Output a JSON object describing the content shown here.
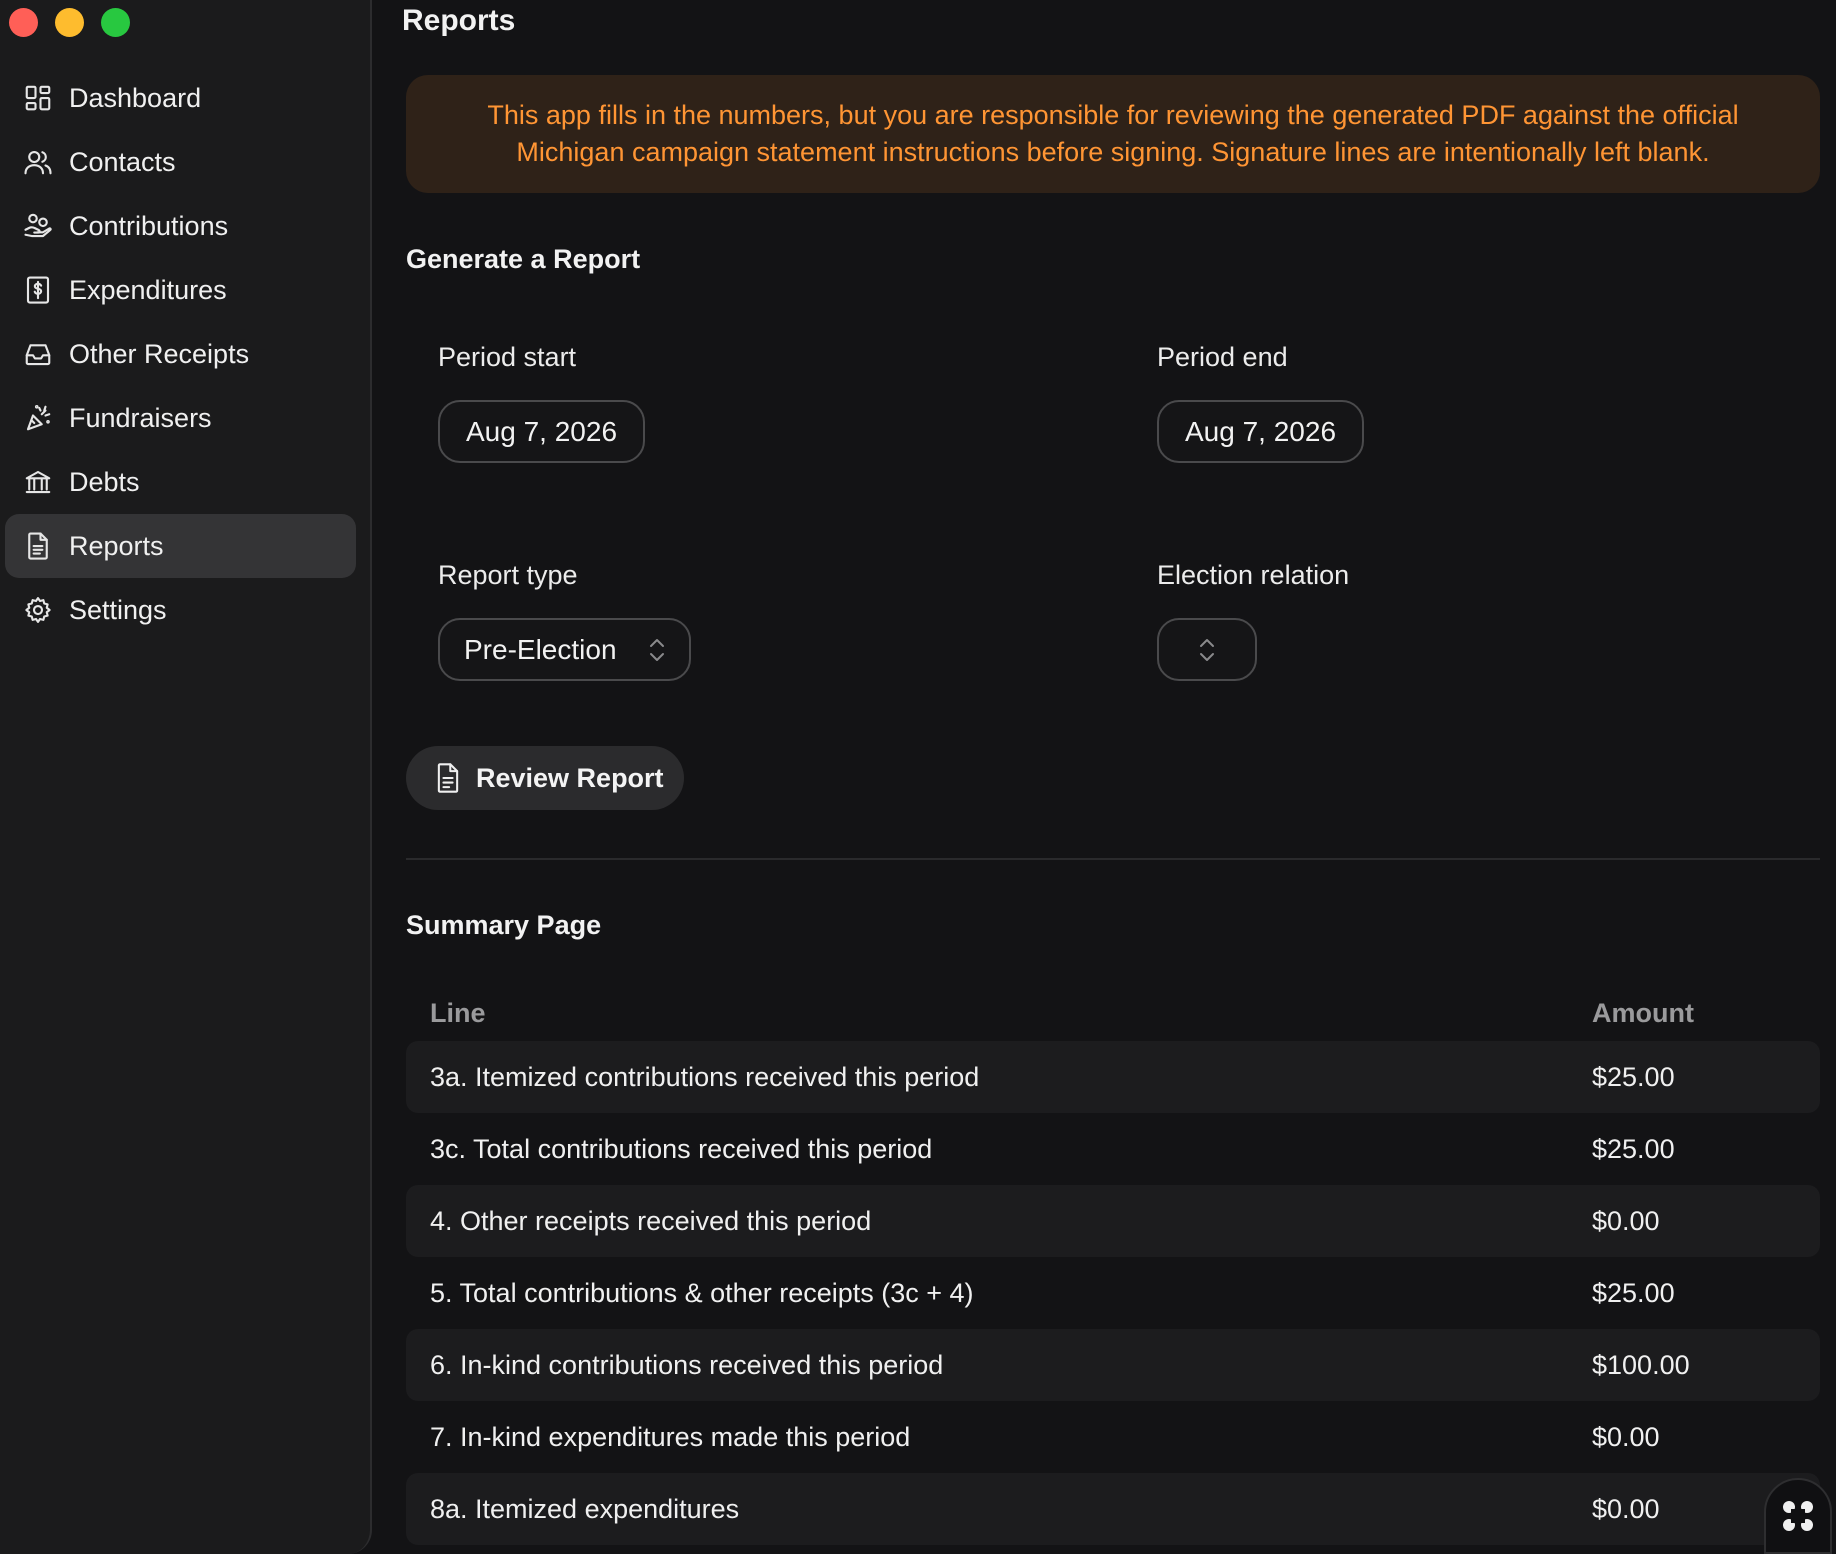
{
  "sidebar": {
    "items": [
      {
        "label": "Dashboard",
        "icon": "dashboard-grid-icon"
      },
      {
        "label": "Contacts",
        "icon": "people-icon"
      },
      {
        "label": "Contributions",
        "icon": "hand-coins-icon"
      },
      {
        "label": "Expenditures",
        "icon": "receipt-dollar-icon"
      },
      {
        "label": "Other Receipts",
        "icon": "inbox-tray-icon"
      },
      {
        "label": "Fundraisers",
        "icon": "party-popper-icon"
      },
      {
        "label": "Debts",
        "icon": "bank-icon"
      },
      {
        "label": "Reports",
        "icon": "document-icon",
        "active": true
      },
      {
        "label": "Settings",
        "icon": "gear-icon"
      }
    ]
  },
  "header": {
    "title": "Reports"
  },
  "banner": {
    "text": "This app fills in the numbers, but you are responsible for reviewing the generated PDF against the official Michigan campaign statement instructions before signing. Signature lines are intentionally left blank.",
    "color": "#ff9534"
  },
  "generate": {
    "title": "Generate a Report",
    "period_start_label": "Period start",
    "period_start_value": "Aug 7, 2026",
    "period_end_label": "Period end",
    "period_end_value": "Aug 7, 2026",
    "report_type_label": "Report type",
    "report_type_value": "Pre-Election",
    "election_relation_label": "Election relation",
    "election_relation_value": "",
    "review_button": "Review Report"
  },
  "summary": {
    "title": "Summary Page",
    "columns": [
      "Line",
      "Amount"
    ],
    "rows": [
      {
        "line": "3a. Itemized contributions received this period",
        "amount": "$25.00"
      },
      {
        "line": "3c. Total contributions received this period",
        "amount": "$25.00"
      },
      {
        "line": "4. Other receipts received this period",
        "amount": "$0.00"
      },
      {
        "line": "5. Total contributions & other receipts (3c + 4)",
        "amount": "$25.00"
      },
      {
        "line": "6. In-kind contributions received this period",
        "amount": "$100.00"
      },
      {
        "line": "7. In-kind expenditures made this period",
        "amount": "$0.00"
      },
      {
        "line": "8a. Itemized expenditures",
        "amount": "$0.00"
      }
    ]
  }
}
